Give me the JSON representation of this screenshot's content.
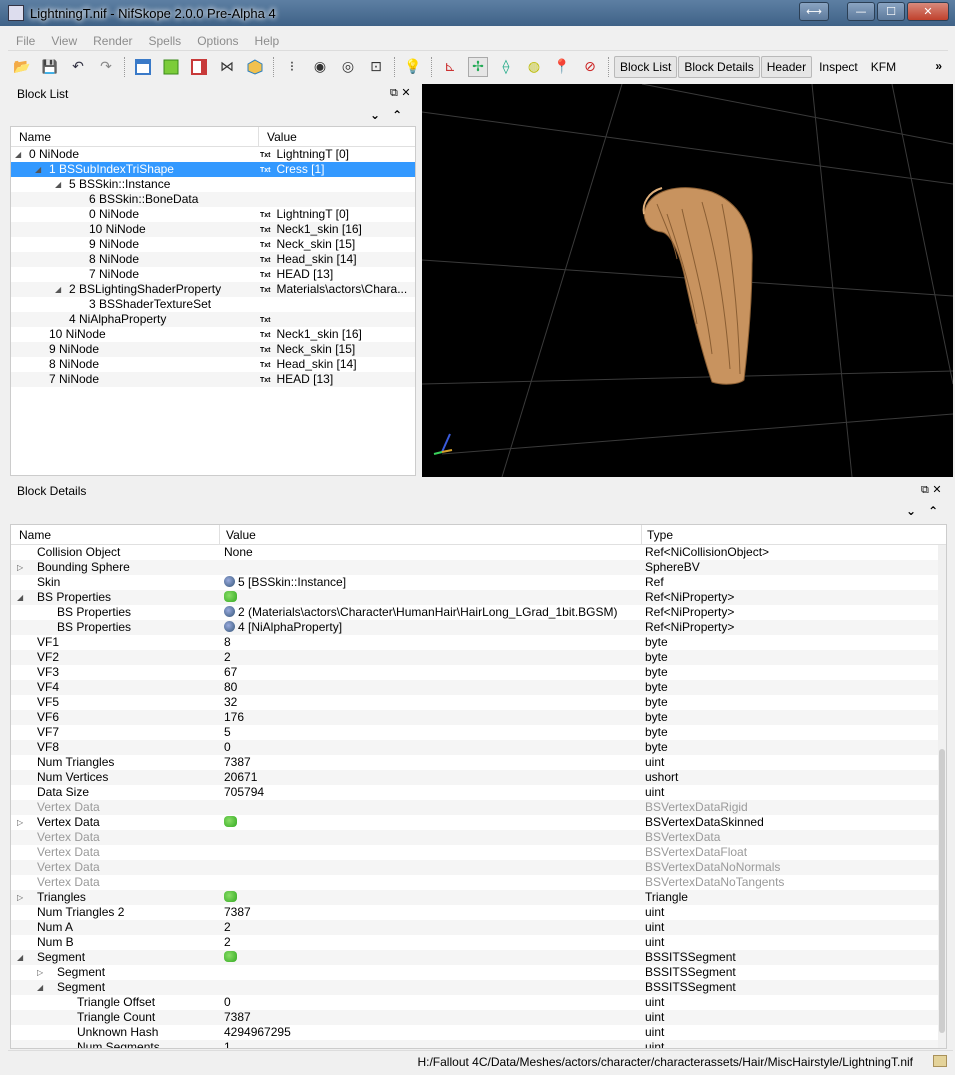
{
  "window": {
    "title": "LightningT.nif - NifSkope 2.0.0 Pre-Alpha 4",
    "buttons": {
      "resize": "⟷",
      "minimize": "—",
      "maximize": "☐",
      "close": "✕"
    }
  },
  "menu": [
    "File",
    "View",
    "Render",
    "Spells",
    "Options",
    "Help"
  ],
  "toolbar": {
    "tabs": [
      "Block List",
      "Block Details",
      "Header",
      "Inspect",
      "KFM"
    ],
    "more": "»"
  },
  "block_list": {
    "title": "Block List",
    "columns": {
      "name": "Name",
      "value": "Value"
    },
    "txt_badge": "Txt",
    "rows": [
      {
        "name": "0 NiNode",
        "value": "LightningT [0]",
        "depth": 0,
        "arrow": "◢"
      },
      {
        "name": "1 BSSubIndexTriShape",
        "value": "Cress [1]",
        "depth": 1,
        "arrow": "◢",
        "selected": true
      },
      {
        "name": "5 BSSkin::Instance",
        "value": "",
        "depth": 2,
        "arrow": "◢"
      },
      {
        "name": "6 BSSkin::BoneData",
        "value": "",
        "depth": 3,
        "arrow": ""
      },
      {
        "name": "0 NiNode",
        "value": "LightningT [0]",
        "depth": 3,
        "arrow": ""
      },
      {
        "name": "10 NiNode",
        "value": "Neck1_skin [16]",
        "depth": 3,
        "arrow": ""
      },
      {
        "name": "9 NiNode",
        "value": "Neck_skin [15]",
        "depth": 3,
        "arrow": ""
      },
      {
        "name": "8 NiNode",
        "value": "Head_skin [14]",
        "depth": 3,
        "arrow": ""
      },
      {
        "name": "7 NiNode",
        "value": "HEAD [13]",
        "depth": 3,
        "arrow": ""
      },
      {
        "name": "2 BSLightingShaderProperty",
        "value": "Materials\\actors\\Chara...",
        "depth": 2,
        "arrow": "◢"
      },
      {
        "name": "3 BSShaderTextureSet",
        "value": "",
        "depth": 3,
        "arrow": ""
      },
      {
        "name": "4 NiAlphaProperty",
        "value": "",
        "depth": 2,
        "arrow": "",
        "txt_only": true
      },
      {
        "name": "10 NiNode",
        "value": "Neck1_skin [16]",
        "depth": 1,
        "arrow": ""
      },
      {
        "name": "9 NiNode",
        "value": "Neck_skin [15]",
        "depth": 1,
        "arrow": ""
      },
      {
        "name": "8 NiNode",
        "value": "Head_skin [14]",
        "depth": 1,
        "arrow": ""
      },
      {
        "name": "7 NiNode",
        "value": "HEAD [13]",
        "depth": 1,
        "arrow": ""
      }
    ]
  },
  "block_details": {
    "title": "Block Details",
    "columns": {
      "name": "Name",
      "value": "Value",
      "type": "Type"
    },
    "rows": [
      {
        "name": "Collision Object",
        "value": "None",
        "type": "Ref<NiCollisionObject>",
        "depth": 0,
        "arrow": ""
      },
      {
        "name": "Bounding Sphere",
        "value": "",
        "type": "SphereBV",
        "depth": 0,
        "arrow": "▷"
      },
      {
        "name": "Skin",
        "value": "5 [BSSkin::Instance]",
        "type": "Ref",
        "depth": 0,
        "arrow": "",
        "icon": "link"
      },
      {
        "name": "BS Properties",
        "value": "",
        "type": "Ref<NiProperty>",
        "depth": 0,
        "arrow": "◢",
        "icon": "array"
      },
      {
        "name": "BS Properties",
        "value": "2 (Materials\\actors\\Character\\HumanHair\\HairLong_LGrad_1bit.BGSM)",
        "type": "Ref<NiProperty>",
        "depth": 1,
        "arrow": "",
        "icon": "link"
      },
      {
        "name": "BS Properties",
        "value": "4 [NiAlphaProperty]",
        "type": "Ref<NiProperty>",
        "depth": 1,
        "arrow": "",
        "icon": "link"
      },
      {
        "name": "VF1",
        "value": "8",
        "type": "byte",
        "depth": 0,
        "arrow": ""
      },
      {
        "name": "VF2",
        "value": "2",
        "type": "byte",
        "depth": 0,
        "arrow": ""
      },
      {
        "name": "VF3",
        "value": "67",
        "type": "byte",
        "depth": 0,
        "arrow": ""
      },
      {
        "name": "VF4",
        "value": "80",
        "type": "byte",
        "depth": 0,
        "arrow": ""
      },
      {
        "name": "VF5",
        "value": "32",
        "type": "byte",
        "depth": 0,
        "arrow": ""
      },
      {
        "name": "VF6",
        "value": "176",
        "type": "byte",
        "depth": 0,
        "arrow": ""
      },
      {
        "name": "VF7",
        "value": "5",
        "type": "byte",
        "depth": 0,
        "arrow": ""
      },
      {
        "name": "VF8",
        "value": "0",
        "type": "byte",
        "depth": 0,
        "arrow": ""
      },
      {
        "name": "Num Triangles",
        "value": "7387",
        "type": "uint",
        "depth": 0,
        "arrow": ""
      },
      {
        "name": "Num Vertices",
        "value": "20671",
        "type": "ushort",
        "depth": 0,
        "arrow": ""
      },
      {
        "name": "Data Size",
        "value": "705794",
        "type": "uint",
        "depth": 0,
        "arrow": ""
      },
      {
        "name": "Vertex Data",
        "value": "",
        "type": "BSVertexDataRigid",
        "depth": 0,
        "arrow": "",
        "grey": true
      },
      {
        "name": "Vertex Data",
        "value": "",
        "type": "BSVertexDataSkinned",
        "depth": 0,
        "arrow": "▷",
        "icon": "array"
      },
      {
        "name": "Vertex Data",
        "value": "",
        "type": "BSVertexData",
        "depth": 0,
        "arrow": "",
        "grey": true
      },
      {
        "name": "Vertex Data",
        "value": "",
        "type": "BSVertexDataFloat",
        "depth": 0,
        "arrow": "",
        "grey": true
      },
      {
        "name": "Vertex Data",
        "value": "",
        "type": "BSVertexDataNoNormals",
        "depth": 0,
        "arrow": "",
        "grey": true
      },
      {
        "name": "Vertex Data",
        "value": "",
        "type": "BSVertexDataNoTangents",
        "depth": 0,
        "arrow": "",
        "grey": true
      },
      {
        "name": "Triangles",
        "value": "",
        "type": "Triangle",
        "depth": 0,
        "arrow": "▷",
        "icon": "array"
      },
      {
        "name": "Num Triangles 2",
        "value": "7387",
        "type": "uint",
        "depth": 0,
        "arrow": ""
      },
      {
        "name": "Num A",
        "value": "2",
        "type": "uint",
        "depth": 0,
        "arrow": ""
      },
      {
        "name": "Num B",
        "value": "2",
        "type": "uint",
        "depth": 0,
        "arrow": ""
      },
      {
        "name": "Segment",
        "value": "",
        "type": "BSSITSSegment",
        "depth": 0,
        "arrow": "◢",
        "icon": "array"
      },
      {
        "name": "Segment",
        "value": "",
        "type": "BSSITSSegment",
        "depth": 1,
        "arrow": "▷"
      },
      {
        "name": "Segment",
        "value": "",
        "type": "BSSITSSegment",
        "depth": 1,
        "arrow": "◢"
      },
      {
        "name": "Triangle Offset",
        "value": "0",
        "type": "uint",
        "depth": 2,
        "arrow": ""
      },
      {
        "name": "Triangle Count",
        "value": "7387",
        "type": "uint",
        "depth": 2,
        "arrow": ""
      },
      {
        "name": "Unknown Hash",
        "value": "4294967295",
        "type": "uint",
        "depth": 2,
        "arrow": ""
      },
      {
        "name": "Num Segments",
        "value": "1",
        "type": "uint",
        "depth": 2,
        "arrow": ""
      }
    ]
  },
  "status": {
    "path": "H:/Fallout 4C/Data/Meshes/actors/character/characterassets/Hair/MiscHairstyle/LightningT.nif"
  },
  "colors": {
    "selection": "#3399ff",
    "titlebar": "#4a6d93",
    "hair": "#c8935f"
  }
}
